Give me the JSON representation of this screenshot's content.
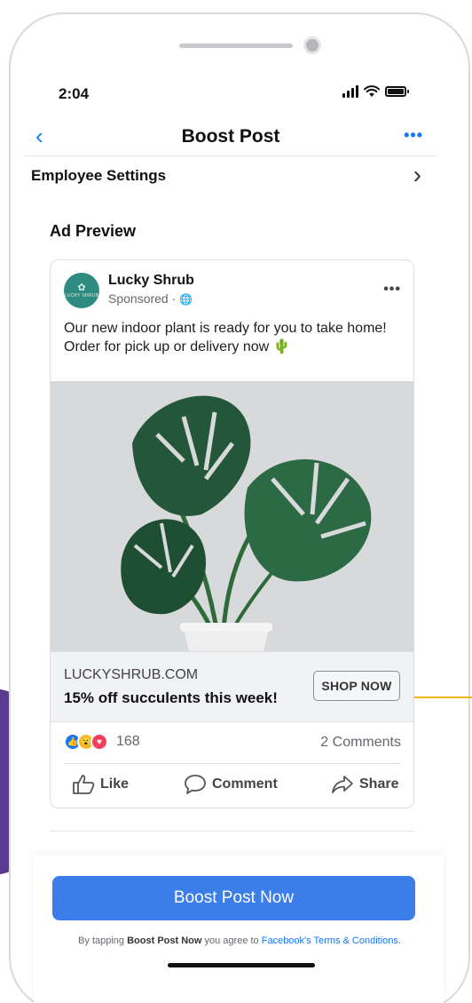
{
  "status_bar": {
    "time": "2:04"
  },
  "nav": {
    "title": "Boost Post"
  },
  "settings": {
    "label": "Employee Settings"
  },
  "preview": {
    "section_title": "Ad Preview"
  },
  "ad": {
    "page_name": "Lucky Shrub",
    "avatar_text": "LUCKY SHRUB",
    "sponsored": "Sponsored · ",
    "body": "Our new indoor plant is ready for you to take home! Order for pick up or delivery now 🌵",
    "domain": "LUCKYSHRUB.COM",
    "headline": "15% off succulents this week!",
    "cta_label": "SHOP NOW",
    "reaction_count": "168",
    "comments": "2 Comments",
    "actions": {
      "like": "Like",
      "comment": "Comment",
      "share": "Share"
    }
  },
  "footer": {
    "boost_button": "Boost Post Now",
    "disclaimer_prefix": "By tapping ",
    "disclaimer_bold": "Boost Post Now",
    "disclaimer_mid": " you agree to ",
    "disclaimer_link": "Facebook's Terms & Conditions",
    "disclaimer_end": "."
  },
  "colors": {
    "accent": "#1877f2",
    "button": "#3b7de9",
    "avatar": "#2e8b81",
    "callout": "#f2b705"
  }
}
